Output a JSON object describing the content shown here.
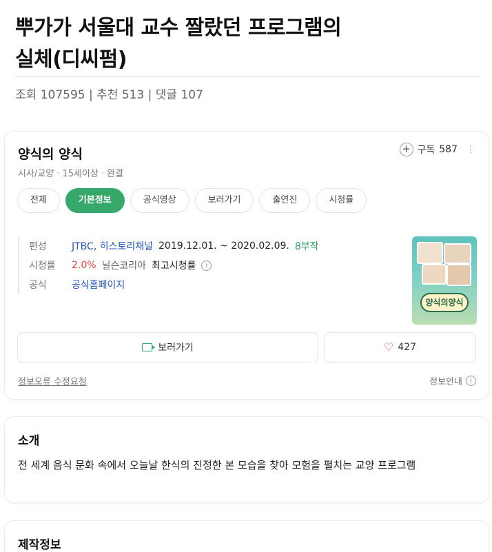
{
  "post": {
    "title_line1": "뿌가가 서울대 교수 짤랐던 프로그램의",
    "title_line2": "실체(디씨펌)",
    "meta": "조회 107595 | 추천 513 | 댓글 107"
  },
  "show": {
    "title": "양식의 양식",
    "genre": "시사/교양",
    "rating": "15세이상",
    "status": "완결",
    "subscribe_label": "구독",
    "subscribe_count": "587",
    "more_icon": "more-vertical-icon"
  },
  "tabs": [
    "전체",
    "기본정보",
    "공식영상",
    "보러가기",
    "출연진",
    "시청률"
  ],
  "info": {
    "broadcast_key": "편성",
    "broadcast_channels": "JTBC, 히스토리채널",
    "broadcast_period": "2019.12.01. ~ 2020.02.09.",
    "broadcast_episodes": "8부작",
    "ratings_key": "시청률",
    "ratings_value": "2.0%",
    "ratings_source": "닐슨코리아",
    "ratings_note": "최고시청률",
    "official_key": "공식",
    "official_link": "공식홈페이지"
  },
  "poster": {
    "logo_text": "양식의양식"
  },
  "actions": {
    "watch_label": "보러가기",
    "like_count": "427",
    "report_label": "정보오류 수정요청",
    "guide_label": "정보안내"
  },
  "intro": {
    "title": "소개",
    "text": "전 세계 음식 문화 속에서 오늘날 한식의 진정한 본 모습을 찾아 모험을 펼치는 교양 프로그램"
  },
  "production": {
    "title": "제작정보"
  },
  "colors": {
    "accent": "#35a86a",
    "link": "#2656b8",
    "rating": "#e0443a"
  }
}
